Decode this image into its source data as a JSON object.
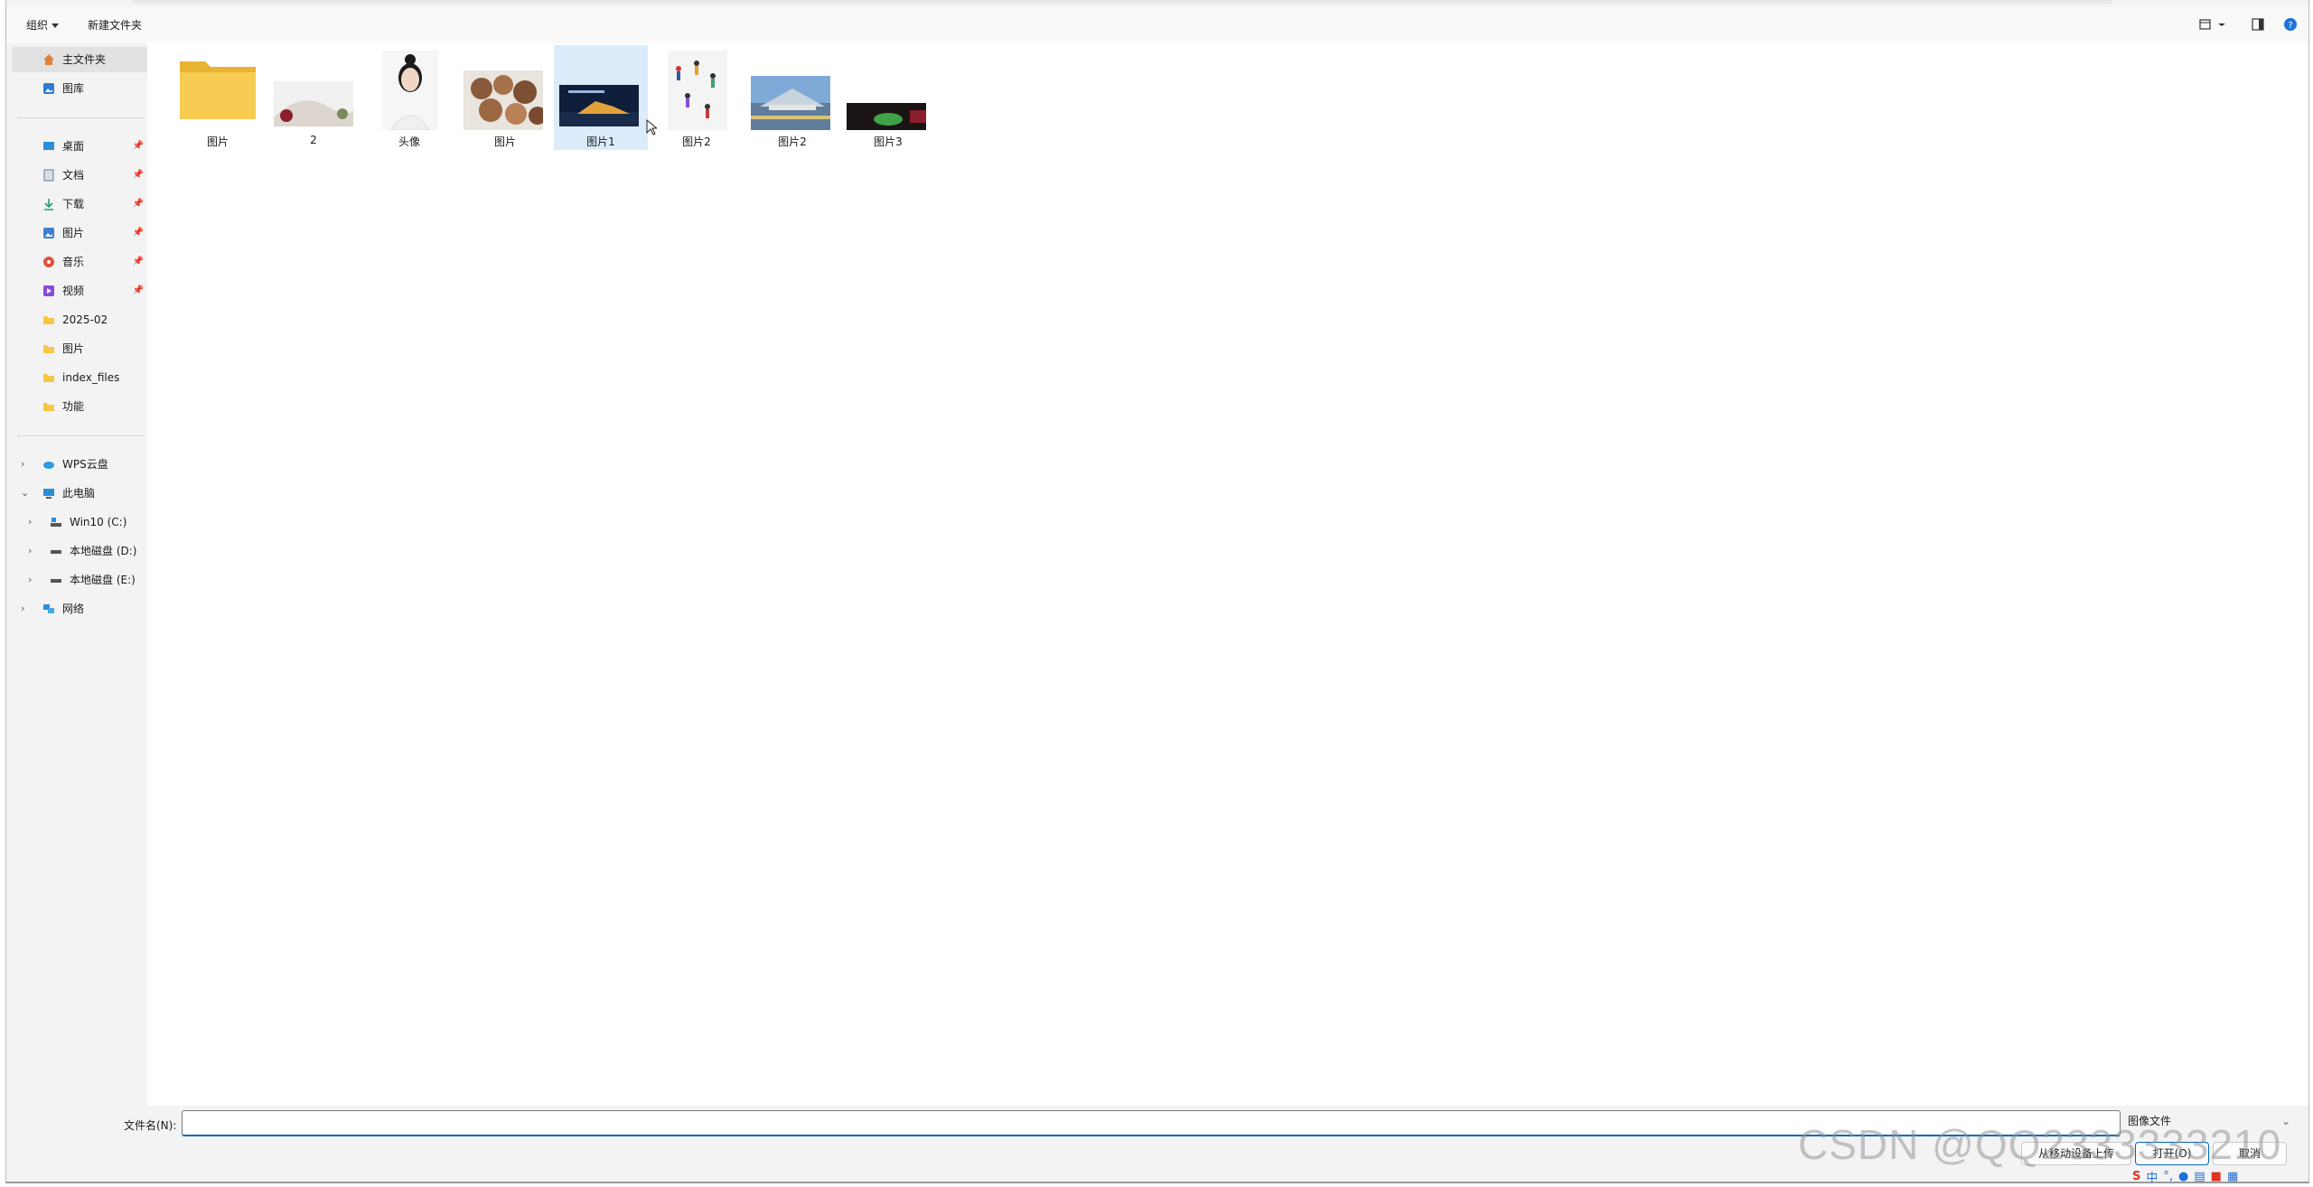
{
  "toolbar": {
    "organize": "组织",
    "new_folder": "新建文件夹"
  },
  "sidebar": {
    "top_items": [
      {
        "label": "主文件夹",
        "icon": "home-icon"
      },
      {
        "label": "图库",
        "icon": "gallery-icon"
      }
    ],
    "quick_access": [
      {
        "label": "桌面",
        "icon": "desktop-icon",
        "pinned": true
      },
      {
        "label": "文档",
        "icon": "documents-icon",
        "pinned": true
      },
      {
        "label": "下载",
        "icon": "download-icon",
        "pinned": true
      },
      {
        "label": "图片",
        "icon": "pictures-icon",
        "pinned": true
      },
      {
        "label": "音乐",
        "icon": "music-icon",
        "pinned": true
      },
      {
        "label": "视频",
        "icon": "video-icon",
        "pinned": true
      },
      {
        "label": "2025-02",
        "icon": "folder-icon",
        "pinned": false
      },
      {
        "label": "图片",
        "icon": "folder-icon",
        "pinned": false
      },
      {
        "label": "index_files",
        "icon": "folder-icon",
        "pinned": false
      },
      {
        "label": "功能",
        "icon": "folder-icon",
        "pinned": false
      }
    ],
    "tree": [
      {
        "label": "WPS云盘",
        "icon": "cloud-icon",
        "expanded": false
      },
      {
        "label": "此电脑",
        "icon": "computer-icon",
        "expanded": true
      },
      {
        "label": "Win10 (C:)",
        "icon": "drive-c-icon",
        "expanded": false
      },
      {
        "label": "本地磁盘 (D:)",
        "icon": "drive-icon",
        "expanded": false
      },
      {
        "label": "本地磁盘 (E:)",
        "icon": "drive-icon",
        "expanded": false
      },
      {
        "label": "网络",
        "icon": "network-icon",
        "expanded": false
      }
    ]
  },
  "files": [
    {
      "name": "图片",
      "kind": "folder"
    },
    {
      "name": "2",
      "kind": "image"
    },
    {
      "name": "头像",
      "kind": "image"
    },
    {
      "name": "图片",
      "kind": "image"
    },
    {
      "name": "图片1",
      "kind": "image",
      "selected": true
    },
    {
      "name": "图片2",
      "kind": "image"
    },
    {
      "name": "图片2",
      "kind": "image"
    },
    {
      "name": "图片3",
      "kind": "image"
    }
  ],
  "bottom": {
    "filename_label": "文件名(N):",
    "filename_value": "",
    "filetype": "图像文件",
    "upload_button": "从移动设备上传",
    "open_button": "打开(O)",
    "cancel_button": "取消"
  },
  "watermark": "CSDN @QQ2333333210",
  "tray": {
    "ime_mode": "中"
  },
  "colors": {
    "accent": "#0067c0",
    "selected_tile": "#dcecfb",
    "sidebar_bg": "#f3f3f3",
    "folder": "#f5c744"
  }
}
